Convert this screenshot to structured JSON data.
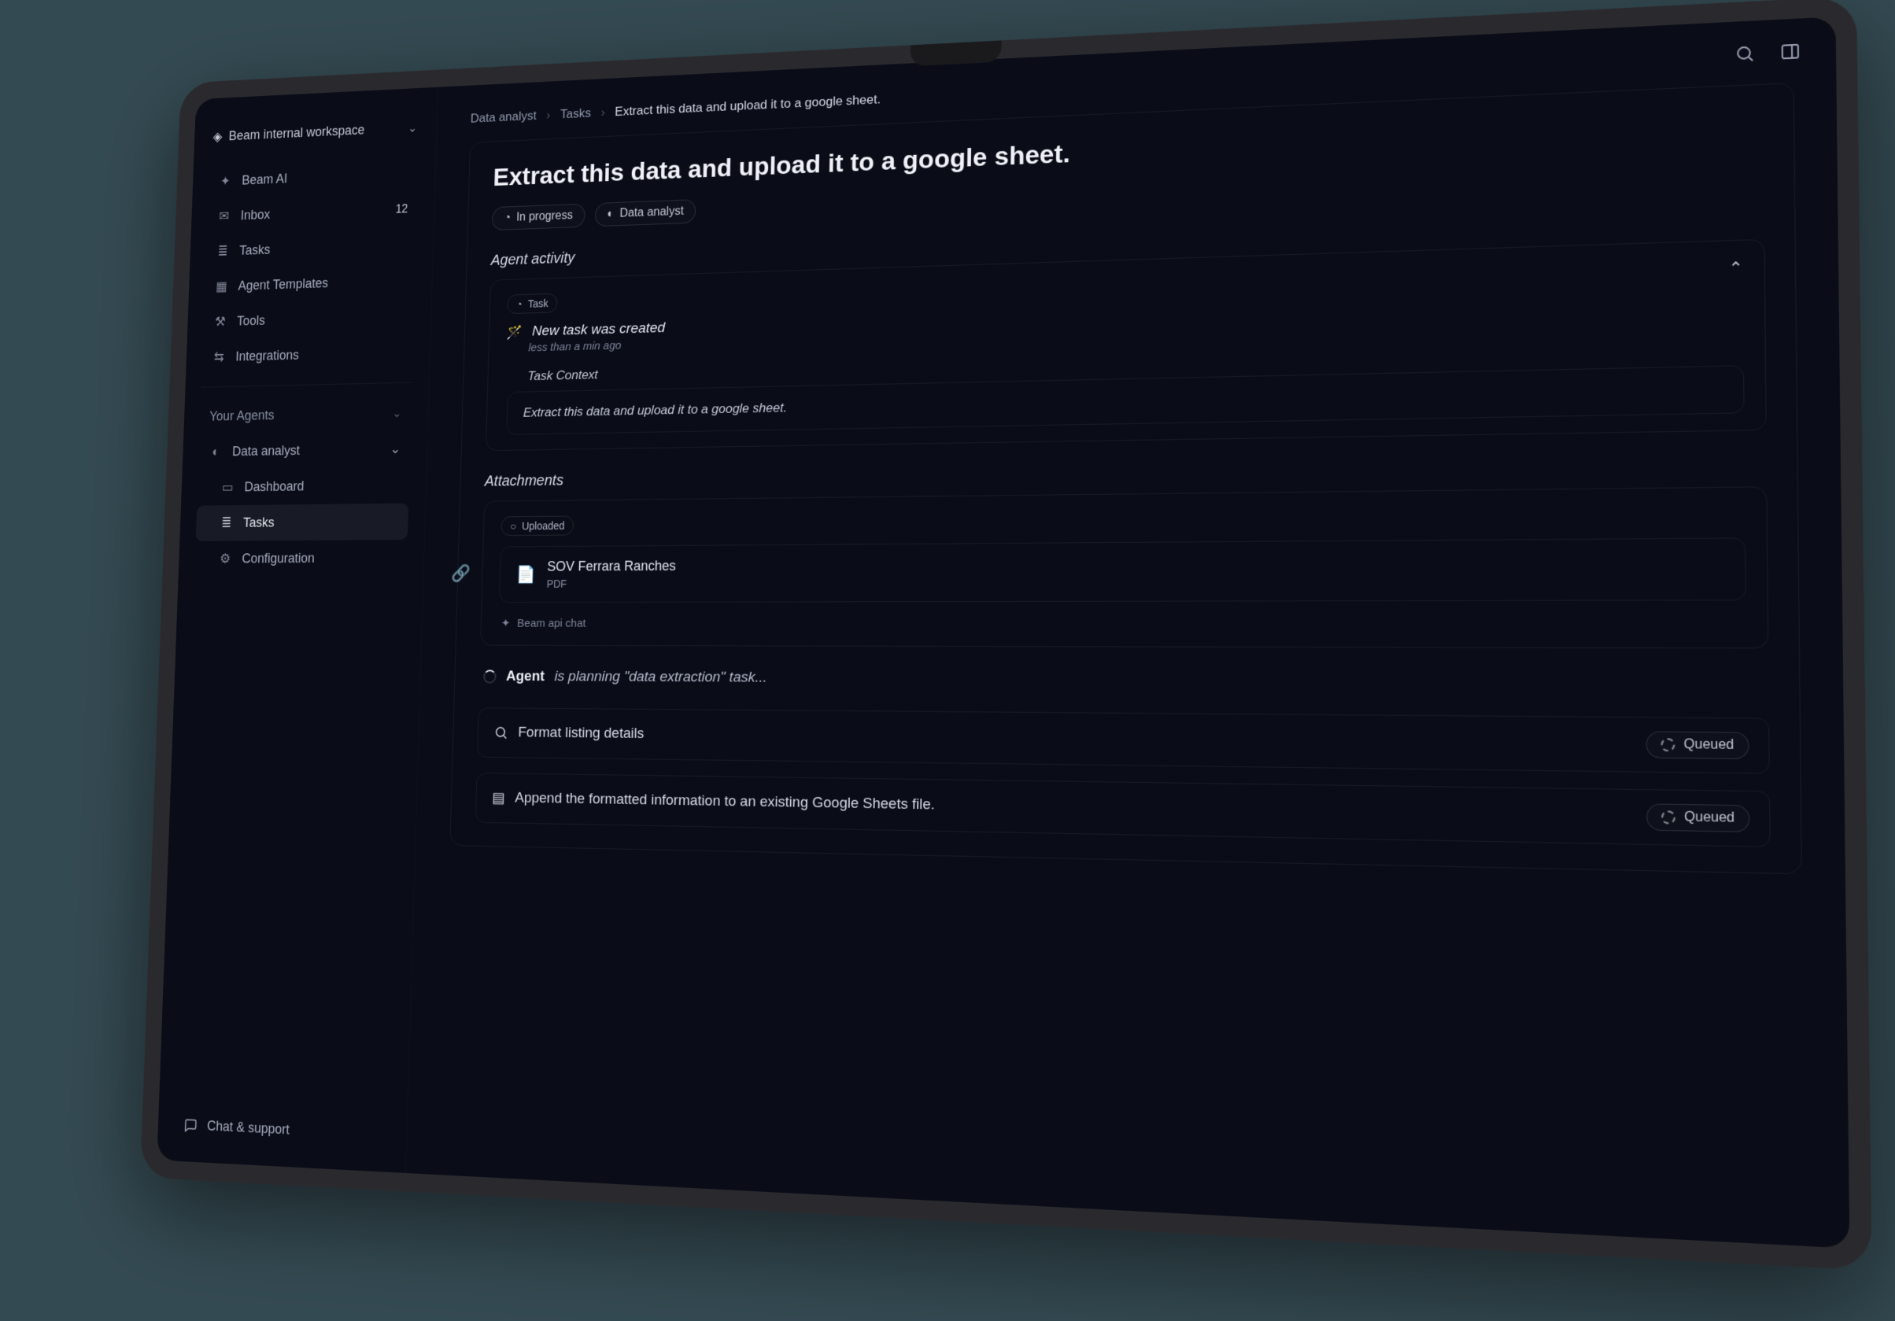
{
  "workspace": {
    "name": "Beam internal workspace"
  },
  "nav": {
    "beam_ai": "Beam AI",
    "inbox": "Inbox",
    "inbox_count": "12",
    "tasks": "Tasks",
    "agent_templates": "Agent Templates",
    "tools": "Tools",
    "integrations": "Integrations"
  },
  "agents": {
    "heading": "Your Agents",
    "data_analyst": "Data analyst",
    "dashboard": "Dashboard",
    "tasks": "Tasks",
    "configuration": "Configuration"
  },
  "footer": {
    "chat_support": "Chat & support"
  },
  "breadcrumb": {
    "a": "Data analyst",
    "b": "Tasks",
    "c": "Extract this data and upload it to a google sheet."
  },
  "page": {
    "title": "Extract this data and upload it to a google sheet.",
    "status": "In progress",
    "agent": "Data analyst"
  },
  "activity": {
    "heading": "Agent activity",
    "badge": "Task",
    "title": "New task was created",
    "time": "less than a min ago",
    "context_label": "Task Context",
    "context_text": "Extract this data and upload it to a google sheet."
  },
  "attachments": {
    "heading": "Attachments",
    "badge": "Uploaded",
    "file_name": "SOV Ferrara Ranches",
    "file_type": "PDF",
    "api_chat": "Beam api chat"
  },
  "steps": {
    "agent_label": "Agent",
    "planning": "is planning \"data extraction\" task...",
    "format": "Format listing details",
    "append": "Append the formatted information to an existing Google Sheets file.",
    "queued": "Queued"
  }
}
